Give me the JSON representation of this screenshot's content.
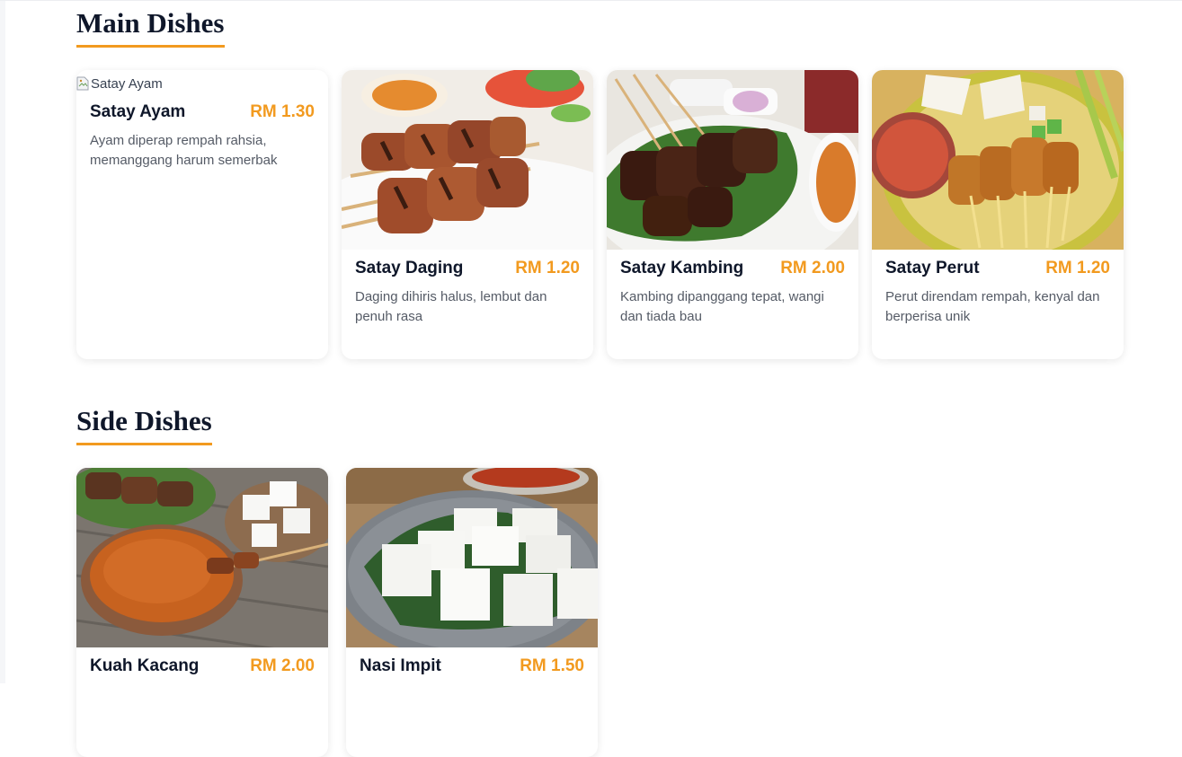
{
  "sections": {
    "main": {
      "title": "Main Dishes",
      "items": [
        {
          "name": "Satay Ayam",
          "price": "RM 1.30",
          "desc": "Ayam diperap rempah rahsia, memanggang harum semerbak",
          "img_alt": "Satay Ayam"
        },
        {
          "name": "Satay Daging",
          "price": "RM 1.20",
          "desc": "Daging dihiris halus, lembut dan penuh rasa"
        },
        {
          "name": "Satay Kambing",
          "price": "RM 2.00",
          "desc": "Kambing dipanggang tepat, wangi dan tiada bau"
        },
        {
          "name": "Satay Perut",
          "price": "RM 1.20",
          "desc": "Perut direndam rempah, kenyal dan berperisa unik"
        }
      ]
    },
    "side": {
      "title": "Side Dishes",
      "items": [
        {
          "name": "Kuah Kacang",
          "price": "RM 2.00"
        },
        {
          "name": "Nasi Impit",
          "price": "RM 1.50"
        }
      ]
    }
  },
  "colors": {
    "accent": "#f29a1f",
    "heading": "#0f172a",
    "description": "#555b66"
  },
  "icons": {
    "broken_image": "broken-image-icon"
  }
}
